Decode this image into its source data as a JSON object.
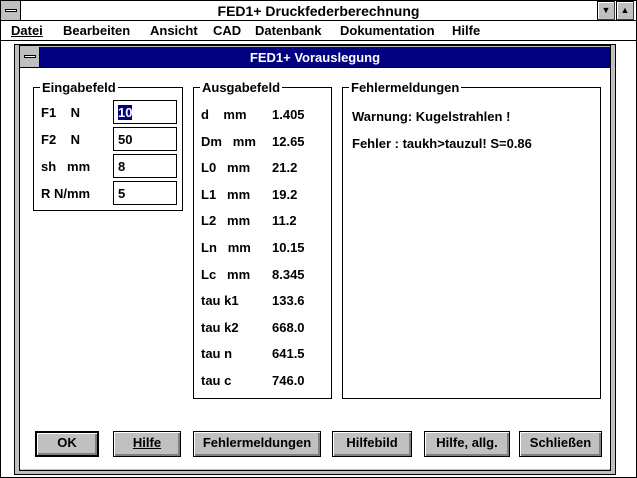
{
  "window": {
    "title": "FED1+   Druckfederberechnung",
    "minimize_glyph": "▼",
    "maximize_glyph": "▲"
  },
  "menu": [
    {
      "label": "Datei",
      "mnemonic_index": 0
    },
    {
      "label": "Bearbeiten",
      "mnemonic_index": 0
    },
    {
      "label": "Ansicht",
      "mnemonic_index": 0
    },
    {
      "label": "CAD",
      "mnemonic_index": 0
    },
    {
      "label": "Datenbank",
      "mnemonic_index": 1
    },
    {
      "label": "Dokumentation",
      "mnemonic_index": 1
    },
    {
      "label": "Hilfe",
      "mnemonic_index": 0
    }
  ],
  "dialog": {
    "title": "FED1+   Vorauslegung"
  },
  "eingabe": {
    "title": "Eingabefeld",
    "rows": [
      {
        "label": "F1    N",
        "value": "10"
      },
      {
        "label": "F2    N",
        "value": "50"
      },
      {
        "label": "sh   mm",
        "value": "8"
      },
      {
        "label": "R N/mm",
        "value": "5"
      }
    ]
  },
  "ausgabe": {
    "title": "Ausgabefeld",
    "rows": [
      {
        "label": "d    mm",
        "value": "1.405"
      },
      {
        "label": "Dm   mm",
        "value": "12.65"
      },
      {
        "label": "L0   mm",
        "value": "21.2"
      },
      {
        "label": "L1   mm",
        "value": "19.2"
      },
      {
        "label": "L2   mm",
        "value": "11.2"
      },
      {
        "label": "Ln   mm",
        "value": "10.15"
      },
      {
        "label": "Lc   mm",
        "value": "8.345"
      },
      {
        "label": "tau k1",
        "value": "133.6"
      },
      {
        "label": "tau k2",
        "value": "668.0"
      },
      {
        "label": "tau n",
        "value": "641.5"
      },
      {
        "label": "tau c",
        "value": "746.0"
      }
    ]
  },
  "fehler": {
    "title": "Fehlermeldungen",
    "messages": [
      "Warnung: Kugelstrahlen !",
      "Fehler : taukh>tauzul! S=0.86"
    ]
  },
  "buttons": [
    {
      "label": "OK"
    },
    {
      "label": "Hilfe"
    },
    {
      "label": "Fehlermeldungen"
    },
    {
      "label": "Hilfebild"
    },
    {
      "label": "Hilfe, allg."
    },
    {
      "label": "Schließen"
    }
  ]
}
